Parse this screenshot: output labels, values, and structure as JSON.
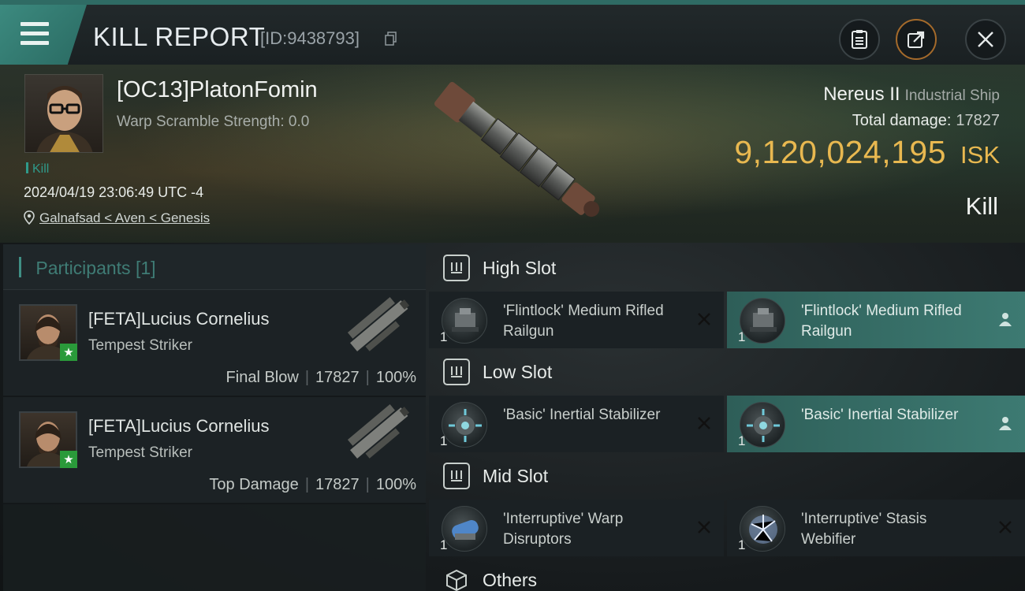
{
  "header": {
    "title": "KILL REPORT",
    "report_id": "[ID:9438793]",
    "icons": [
      "menu-icon",
      "copy-icon",
      "clipboard-icon",
      "share-icon",
      "close-icon"
    ]
  },
  "victim": {
    "name": "[OC13]PlatonFomin",
    "warp_scramble": "Warp Scramble Strength: 0.0",
    "tag": "Kill",
    "datetime": "2024/04/19 23:06:49 UTC -4",
    "location": "Galnafsad < Aven < Genesis",
    "ship_name": "Nereus II",
    "ship_class": "Industrial Ship",
    "total_damage_label": "Total damage:",
    "total_damage": "17827",
    "isk_amount": "9,120,024,195",
    "isk_unit": "ISK",
    "status": "Kill"
  },
  "participants": {
    "label": "Participants",
    "count": "[1]",
    "rows": [
      {
        "name": "[FETA]Lucius Cornelius",
        "ship": "Tempest Striker",
        "role": "Final Blow",
        "damage": "17827",
        "percent": "100%"
      },
      {
        "name": "[FETA]Lucius Cornelius",
        "ship": "Tempest Striker",
        "role": "Top Damage",
        "damage": "17827",
        "percent": "100%"
      }
    ]
  },
  "fitting": {
    "slots": [
      {
        "title": "High Slot",
        "modules": [
          {
            "qty": "1",
            "name": "'Flintlock' Medium Rifled Railgun",
            "mark": "x-icon"
          },
          {
            "qty": "1",
            "name": "'Flintlock' Medium Rifled Railgun",
            "mark": "person-icon"
          }
        ]
      },
      {
        "title": "Low Slot",
        "modules": [
          {
            "qty": "1",
            "name": "'Basic' Inertial Stabilizer",
            "mark": "x-icon"
          },
          {
            "qty": "1",
            "name": "'Basic' Inertial Stabilizer",
            "mark": "person-icon"
          }
        ]
      },
      {
        "title": "Mid Slot",
        "modules": [
          {
            "qty": "1",
            "name": "'Interruptive' Warp Disruptors",
            "mark": "x-icon"
          },
          {
            "qty": "1",
            "name": "'Interruptive' Stasis Webifier",
            "mark": "x-icon"
          }
        ]
      },
      {
        "title": "Others",
        "modules": []
      }
    ]
  },
  "colors": {
    "accent": "#3c8a7f",
    "isk_gold": "#e8b850",
    "fitted_bg": "#3d7a72"
  }
}
